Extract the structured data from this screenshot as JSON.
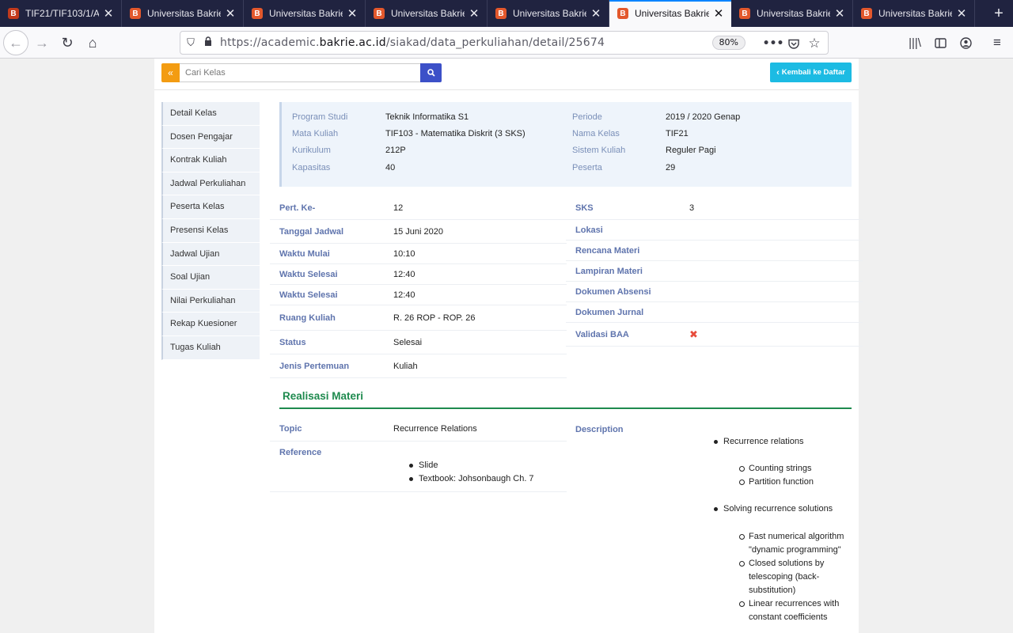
{
  "browser": {
    "tabs": [
      {
        "title": "TIF21/TIF103/1/A",
        "active": false
      },
      {
        "title": "Universitas Bakrie",
        "active": false
      },
      {
        "title": "Universitas Bakrie",
        "active": false
      },
      {
        "title": "Universitas Bakrie",
        "active": false
      },
      {
        "title": "Universitas Bakrie",
        "active": false
      },
      {
        "title": "Universitas Bakrie",
        "active": true
      },
      {
        "title": "Universitas Bakrie",
        "active": false
      },
      {
        "title": "Universitas Bakrie",
        "active": false
      }
    ],
    "url_prefix": "https://academic.",
    "url_domain": "bakrie.ac.id",
    "url_path": "/siakad/data_perkuliahan/detail/25674",
    "zoom": "80%"
  },
  "search": {
    "placeholder": "Cari Kelas",
    "back_label": "«"
  },
  "back_to_list": "Kembali ke Daftar",
  "menu": [
    "Detail Kelas",
    "Dosen Pengajar",
    "Kontrak Kuliah",
    "Jadwal Perkuliahan",
    "Peserta Kelas",
    "Presensi Kelas",
    "Jadwal Ujian",
    "Soal Ujian",
    "Nilai Perkuliahan",
    "Rekap Kuesioner",
    "Tugas Kuliah"
  ],
  "info": {
    "program_studi": {
      "label": "Program Studi",
      "value": "Teknik Informatika S1"
    },
    "mata_kuliah": {
      "label": "Mata Kuliah",
      "value": "TIF103 - Matematika Diskrit (3 SKS)"
    },
    "kurikulum": {
      "label": "Kurikulum",
      "value": "212P"
    },
    "kapasitas": {
      "label": "Kapasitas",
      "value": "40"
    },
    "periode": {
      "label": "Periode",
      "value": "2019 / 2020 Genap"
    },
    "nama_kelas": {
      "label": "Nama Kelas",
      "value": "TIF21"
    },
    "sistem_kuliah": {
      "label": "Sistem Kuliah",
      "value": "Reguler Pagi"
    },
    "peserta": {
      "label": "Peserta",
      "value": "29"
    }
  },
  "details_left": {
    "pertemuan": {
      "label": "Pert. Ke-",
      "value": "12"
    },
    "tanggal": {
      "label": "Tanggal Jadwal",
      "value": "15 Juni 2020"
    },
    "mulai": {
      "label": "Waktu Mulai",
      "value": "10:10"
    },
    "selesai1": {
      "label": "Waktu Selesai",
      "value": "12:40"
    },
    "selesai2": {
      "label": "Waktu Selesai",
      "value": "12:40"
    },
    "ruang": {
      "label": "Ruang Kuliah",
      "value": "R. 26 ROP - ROP. 26"
    },
    "status": {
      "label": "Status",
      "value": "Selesai"
    },
    "jenis": {
      "label": "Jenis Pertemuan",
      "value": "Kuliah"
    }
  },
  "details_right": {
    "sks": {
      "label": "SKS",
      "value": "3"
    },
    "lokasi": {
      "label": "Lokasi",
      "value": ""
    },
    "rencana": {
      "label": "Rencana Materi",
      "value": ""
    },
    "lampiran": {
      "label": "Lampiran Materi",
      "value": ""
    },
    "absensi": {
      "label": "Dokumen Absensi",
      "value": ""
    },
    "jurnal": {
      "label": "Dokumen Jurnal",
      "value": ""
    },
    "validasi": {
      "label": "Validasi BAA",
      "value": "✖"
    }
  },
  "realisasi": {
    "title": "Realisasi Materi",
    "topic_label": "Topic",
    "topic_value": "Recurrence Relations",
    "reference_label": "Reference",
    "references": [
      "Slide",
      "Textbook: Johsonbaugh Ch. 7"
    ],
    "description_label": "Description",
    "description": {
      "item1": "Recurrence relations",
      "item1_sub1": "Counting strings",
      "item1_sub2": "Partition function",
      "item2": "Solving recurrence solutions",
      "item2_sub1": "Fast numerical algorithm \"dynamic programming\"",
      "item2_sub2": "Closed solutions by telescoping (back-substitution)",
      "item2_sub3": "Linear recurrences with constant coefficients"
    }
  }
}
